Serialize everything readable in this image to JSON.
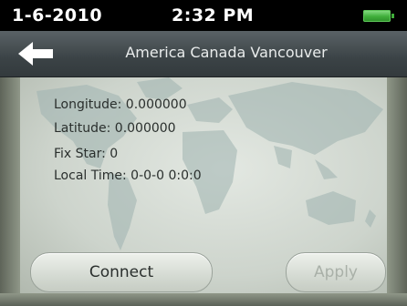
{
  "status": {
    "date": "1-6-2010",
    "time": "2:32 PM",
    "battery_color": "#3fae3a"
  },
  "header": {
    "back_icon": "back-arrow-icon",
    "title": "America Canada Vancouver"
  },
  "gps_info": {
    "longitude": "Longitude: 0.000000",
    "latitude": "Latitude: 0.000000",
    "fix_star": "Fix Star: 0",
    "local_time": "Local Time:  0-0-0 0:0:0"
  },
  "buttons": {
    "connect": "Connect",
    "apply": "Apply"
  }
}
